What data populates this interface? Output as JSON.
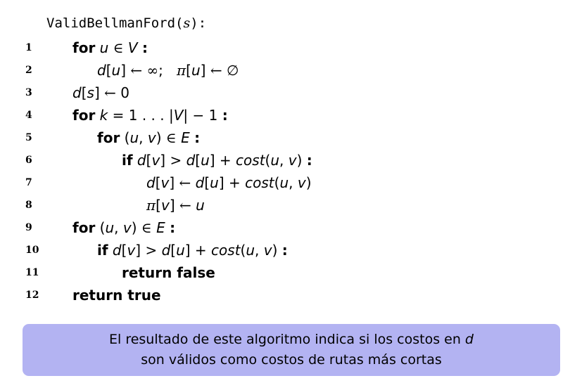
{
  "algorithm": {
    "name": "ValidBellmanFord",
    "param": "s"
  },
  "lines": [
    {
      "num": "1"
    },
    {
      "num": "2"
    },
    {
      "num": "3"
    },
    {
      "num": "4"
    },
    {
      "num": "5"
    },
    {
      "num": "6"
    },
    {
      "num": "7"
    },
    {
      "num": "8"
    },
    {
      "num": "9"
    },
    {
      "num": "10"
    },
    {
      "num": "11"
    },
    {
      "num": "12"
    }
  ],
  "keywords": {
    "for": "for",
    "if": "if",
    "return_false": "return false",
    "return_true": "return true"
  },
  "callout": {
    "line1": "El resultado de este algoritmo indica si los costos en ",
    "line1_var": "d",
    "line2": "son válidos como costos de rutas más cortas"
  },
  "colors": {
    "callout_bg": "#b3b3f2"
  }
}
